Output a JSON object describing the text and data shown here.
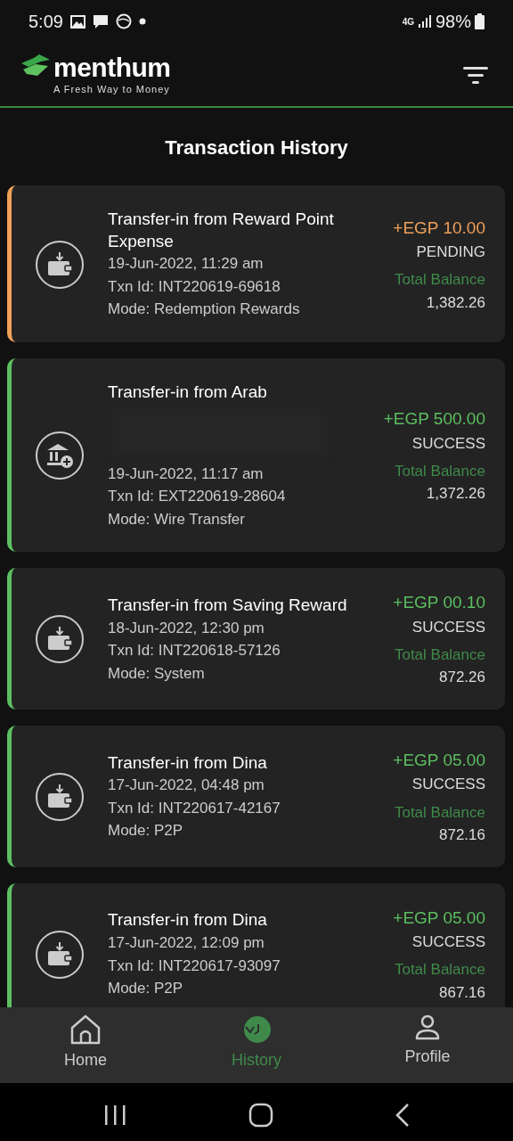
{
  "status_bar": {
    "time": "5:09",
    "network": "4G",
    "battery": "98%"
  },
  "header": {
    "brand": "menthum",
    "tagline": "A Fresh Way to Money"
  },
  "title": "Transaction History",
  "transactions": [
    {
      "kind": "wallet",
      "color": "#f0a05a",
      "title": "Transfer-in from Reward Point Expense",
      "redacted": false,
      "date": "19-Jun-2022, 11:29 am",
      "txn": "Txn Id: INT220619-69618",
      "mode": "Mode: Redemption Rewards",
      "amount": "+EGP 10.00",
      "status_label": "PENDING",
      "balance_label": "Total Balance",
      "balance": "1,382.26"
    },
    {
      "kind": "bank",
      "color": "#5cbf60",
      "title": "Transfer-in from Arab",
      "redacted": true,
      "date": "19-Jun-2022, 11:17 am",
      "txn": "Txn Id: EXT220619-28604",
      "mode": "Mode: Wire Transfer",
      "amount": "+EGP 500.00",
      "status_label": "SUCCESS",
      "balance_label": "Total Balance",
      "balance": "1,372.26"
    },
    {
      "kind": "wallet",
      "color": "#5cbf60",
      "title": "Transfer-in from Saving Reward",
      "redacted": false,
      "date": "18-Jun-2022, 12:30 pm",
      "txn": "Txn Id: INT220618-57126",
      "mode": "Mode: System",
      "amount": "+EGP 00.10",
      "status_label": "SUCCESS",
      "balance_label": "Total Balance",
      "balance": "872.26"
    },
    {
      "kind": "wallet",
      "color": "#5cbf60",
      "title": "Transfer-in from Dina",
      "redacted": false,
      "date": "17-Jun-2022, 04:48 pm",
      "txn": "Txn Id: INT220617-42167",
      "mode": "Mode: P2P",
      "amount": "+EGP 05.00",
      "status_label": "SUCCESS",
      "balance_label": "Total Balance",
      "balance": "872.16"
    },
    {
      "kind": "wallet",
      "color": "#5cbf60",
      "title": "Transfer-in from Dina",
      "redacted": false,
      "date": "17-Jun-2022, 12:09 pm",
      "txn": "Txn Id: INT220617-93097",
      "mode": "Mode: P2P",
      "amount": "+EGP 05.00",
      "status_label": "SUCCESS",
      "balance_label": "Total Balance",
      "balance": "867.16"
    }
  ],
  "bottom_nav": [
    {
      "label": "Home",
      "kind": "home",
      "selected": false
    },
    {
      "label": "History",
      "kind": "history",
      "selected": true
    },
    {
      "label": "Profile",
      "kind": "profile",
      "selected": false
    }
  ]
}
